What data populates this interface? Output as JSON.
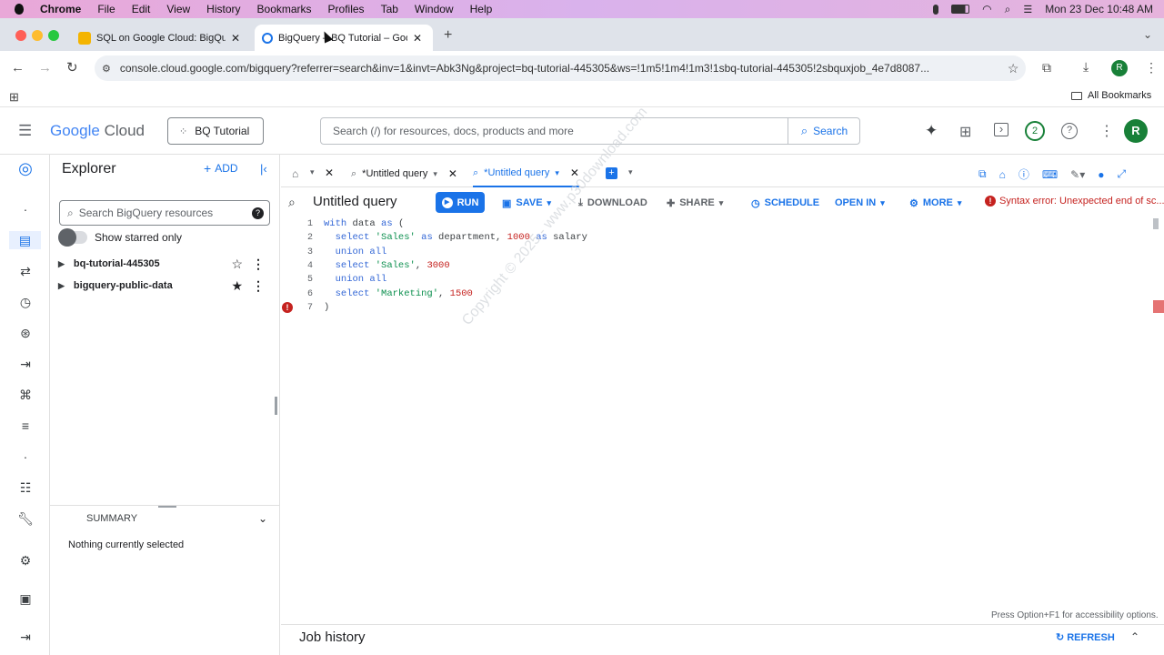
{
  "menubar": {
    "apple": "",
    "app": "Chrome",
    "items": [
      "File",
      "Edit",
      "View",
      "History",
      "Bookmarks",
      "Profiles",
      "Tab",
      "Window",
      "Help"
    ],
    "datetime": "Mon 23 Dec  10:48 AM"
  },
  "tabs": [
    {
      "title": "SQL on Google Cloud: BigQu",
      "favicon_color": "#f4b400"
    },
    {
      "title": "BigQuery – BQ Tutorial – Goo",
      "favicon_color": "#1a73e8"
    }
  ],
  "address": {
    "url": "console.cloud.google.com/bigquery?referrer=search&inv=1&invt=Abk3Ng&project=bq-tutorial-445305&ws=!1m5!1m4!1m3!1sbq-tutorial-445305!2sbquxjob_4e7d8087..."
  },
  "bookmarks": {
    "all": "All Bookmarks"
  },
  "gcp": {
    "logo_google": "Google",
    "logo_cloud": "Cloud",
    "project": "BQ Tutorial",
    "search_placeholder": "Search (/) for resources, docs, products and more",
    "search_button": "Search",
    "notif_count": "2",
    "avatar": "R"
  },
  "explorer": {
    "title": "Explorer",
    "add": "ADD",
    "search_placeholder": "Search BigQuery resources",
    "starred": "Show starred only",
    "items": [
      {
        "name": "bq-tutorial-445305",
        "starred": false
      },
      {
        "name": "bigquery-public-data",
        "starred": true
      }
    ],
    "summary": "SUMMARY",
    "nothing": "Nothing currently selected"
  },
  "query_tabs": [
    "*Untitled query",
    "*Untitled query"
  ],
  "query": {
    "title": "Untitled query",
    "run": "RUN",
    "save": "SAVE",
    "download": "DOWNLOAD",
    "share": "SHARE",
    "schedule": "SCHEDULE",
    "open_in": "OPEN IN",
    "more": "MORE",
    "error": "Syntax error: Unexpected end of sc..."
  },
  "code_lines": [
    {
      "n": "1",
      "parts": [
        [
          "kw",
          "with "
        ],
        [
          "",
          "data "
        ],
        [
          "kw",
          "as "
        ],
        [
          "",
          "("
        ]
      ]
    },
    {
      "n": "2",
      "parts": [
        [
          "kw",
          "  select "
        ],
        [
          "str",
          "'Sales' "
        ],
        [
          "kw",
          "as "
        ],
        [
          "",
          "department, "
        ],
        [
          "num",
          "1000 "
        ],
        [
          "kw",
          "as "
        ],
        [
          "",
          "salary"
        ]
      ]
    },
    {
      "n": "3",
      "parts": [
        [
          "kw",
          "  union all"
        ]
      ]
    },
    {
      "n": "4",
      "parts": [
        [
          "kw",
          "  select "
        ],
        [
          "str",
          "'Sales'"
        ],
        [
          "",
          ", "
        ],
        [
          "num",
          "3000"
        ]
      ]
    },
    {
      "n": "5",
      "parts": [
        [
          "kw",
          "  union all"
        ]
      ]
    },
    {
      "n": "6",
      "parts": [
        [
          "kw",
          "  select "
        ],
        [
          "str",
          "'Marketing'"
        ],
        [
          "",
          ", "
        ],
        [
          "num",
          "1500"
        ]
      ]
    },
    {
      "n": "7",
      "parts": [
        [
          "",
          ")"
        ]
      ]
    }
  ],
  "watermark": "Copyright © 2025 - www.p30download.com",
  "a11y": "Press Option+F1 for accessibility options.",
  "job_history": {
    "title": "Job history",
    "refresh": "REFRESH"
  }
}
